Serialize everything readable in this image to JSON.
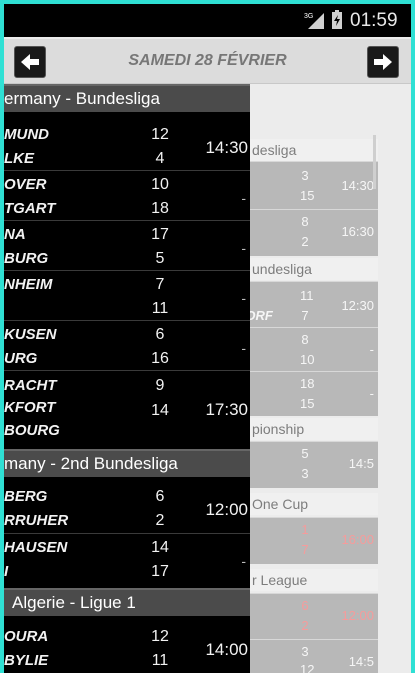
{
  "status_bar": {
    "network": "3G",
    "time": "01:59"
  },
  "header": {
    "date": "SAMEDI 28 FÉVRIER"
  },
  "drawer": {
    "leagues": [
      {
        "name": "ermany - Bundesliga",
        "matches": [
          {
            "home": "MUND",
            "away": "LKE",
            "hs": "12",
            "as": "4",
            "time": "14:30"
          },
          {
            "home": "OVER",
            "away": "TGART",
            "hs": "10",
            "as": "18",
            "time": "-"
          },
          {
            "home": "NA",
            "away": "BURG",
            "hs": "17",
            "as": "5",
            "time": "-"
          },
          {
            "home": "NHEIM",
            "away": "",
            "hs": "7",
            "as": "11",
            "time": "-"
          },
          {
            "home": "KUSEN",
            "away": "URG",
            "hs": "6",
            "as": "16",
            "time": "-"
          },
          {
            "home": "RACHT",
            "mid": "KFORT",
            "away": "BOURG",
            "hs": "9",
            "as": "14",
            "time": "17:30"
          }
        ]
      },
      {
        "name": "many - 2nd Bundesliga",
        "matches": [
          {
            "home": "BERG",
            "away": "RRUHER",
            "hs": "6",
            "as": "2",
            "time": "12:00"
          },
          {
            "home": "HAUSEN",
            "away": "I",
            "hs": "14",
            "as": "17",
            "time": "-"
          }
        ]
      },
      {
        "name": "Algerie - Ligue 1",
        "matches": [
          {
            "home": "OURA",
            "away": "BYLIE",
            "hs": "12",
            "as": "11",
            "time": "14:00"
          }
        ]
      }
    ]
  },
  "background": {
    "headers": [
      "desliga",
      "undesliga",
      "pionship",
      "One Cup",
      "r League"
    ],
    "rows": [
      {
        "hs": "3",
        "as": "15",
        "time": "14:30"
      },
      {
        "hs": "8",
        "as": "2",
        "time": "16:30"
      },
      {
        "left": "DORF",
        "hs": "11",
        "as": "7",
        "time": "12:30"
      },
      {
        "hs": "8",
        "as": "10",
        "time": "-"
      },
      {
        "hs": "18",
        "as": "15",
        "time": "-"
      },
      {
        "hs": "5",
        "as": "3",
        "time": "14:5"
      },
      {
        "hs": "1",
        "as": "7",
        "time": "16:00"
      },
      {
        "hs": "6",
        "as": "2",
        "time": "12:00"
      },
      {
        "hs": "3",
        "as": "12",
        "time": "14:5"
      }
    ]
  },
  "colors": {
    "frame": "#2fe0d4",
    "drawer": "#000000",
    "league_header": "#4b4b4b",
    "live_score": "#ff5a5a"
  }
}
